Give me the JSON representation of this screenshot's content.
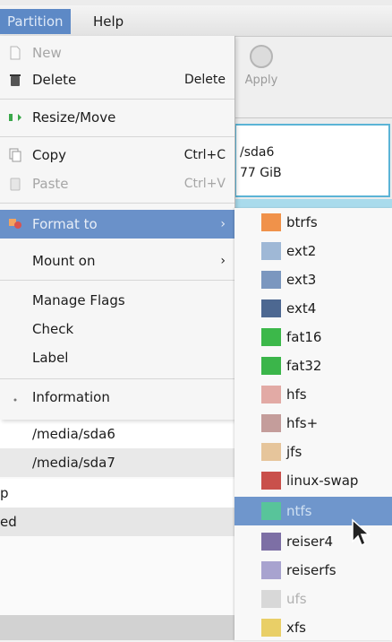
{
  "menubar": {
    "partition": "Partition",
    "help": "Help"
  },
  "toolbar": {
    "apply": "Apply"
  },
  "diskmap": {
    "line1": "/sda6",
    "line2": "77 GiB"
  },
  "partition_menu": {
    "items": [
      {
        "label": "New",
        "accel": "",
        "enabled": false,
        "icon": "new-file-icon"
      },
      {
        "label": "Delete",
        "accel": "Delete",
        "enabled": true,
        "icon": "trash-icon"
      },
      {
        "label": "Resize/Move",
        "accel": "",
        "enabled": true,
        "icon": "resize-arrow-icon"
      },
      {
        "label": "Copy",
        "accel": "Ctrl+C",
        "enabled": true,
        "icon": "copy-icon"
      },
      {
        "label": "Paste",
        "accel": "Ctrl+V",
        "enabled": false,
        "icon": "paste-icon"
      },
      {
        "label": "Format to",
        "accel": "",
        "enabled": true,
        "icon": "format-icon"
      },
      {
        "label": "Mount on",
        "accel": "",
        "enabled": true,
        "icon": ""
      },
      {
        "label": "Manage Flags",
        "accel": "",
        "enabled": true,
        "icon": ""
      },
      {
        "label": "Check",
        "accel": "",
        "enabled": true,
        "icon": ""
      },
      {
        "label": "Label",
        "accel": "",
        "enabled": true,
        "icon": ""
      },
      {
        "label": "Information",
        "accel": "",
        "enabled": true,
        "icon": "info-icon"
      }
    ]
  },
  "background_rows": {
    "mount_rows": [
      "/media/sda6",
      "/media/sda7"
    ],
    "fragments": [
      "p",
      "ed"
    ]
  },
  "filesystems": [
    {
      "name": "btrfs",
      "color": "#f0924a",
      "enabled": true
    },
    {
      "name": "ext2",
      "color": "#9fb8d6",
      "enabled": true
    },
    {
      "name": "ext3",
      "color": "#7b97bf",
      "enabled": true
    },
    {
      "name": "ext4",
      "color": "#4d6891",
      "enabled": true
    },
    {
      "name": "fat16",
      "color": "#3cb84a",
      "enabled": true
    },
    {
      "name": "fat32",
      "color": "#3bb54a",
      "enabled": true
    },
    {
      "name": "hfs",
      "color": "#e2aaa5",
      "enabled": true
    },
    {
      "name": "hfs+",
      "color": "#c49d9b",
      "enabled": true
    },
    {
      "name": "jfs",
      "color": "#e6c59b",
      "enabled": true
    },
    {
      "name": "linux-swap",
      "color": "#c9504b",
      "enabled": true
    },
    {
      "name": "ntfs",
      "color": "#58c49a",
      "enabled": true,
      "selected": true
    },
    {
      "name": "reiser4",
      "color": "#7d6fa5",
      "enabled": true
    },
    {
      "name": "reiserfs",
      "color": "#a8a3cf",
      "enabled": true
    },
    {
      "name": "ufs",
      "color": "#d8d8d8",
      "enabled": false
    },
    {
      "name": "xfs",
      "color": "#e9cf67",
      "enabled": true
    }
  ]
}
